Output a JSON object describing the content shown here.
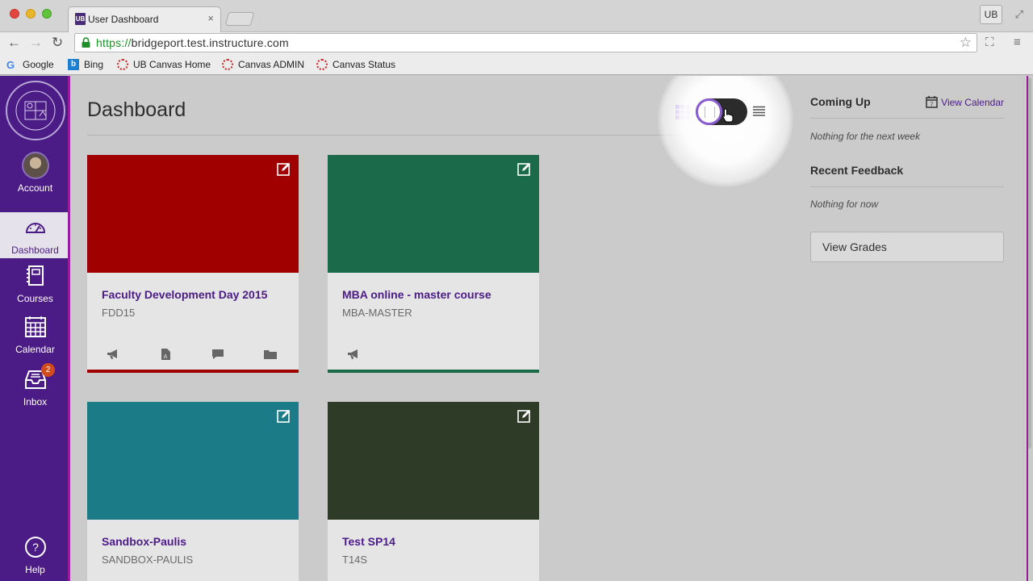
{
  "browser": {
    "tab_title": "User Dashboard",
    "tab_favicon": "UB",
    "tab_close": "×",
    "profile": "UB",
    "url_scheme": "https://",
    "url_rest": "bridgeport.test.instructure.com",
    "bookmarks": [
      {
        "label": "Google",
        "icon": "google-icon"
      },
      {
        "label": "Bing",
        "icon": "bing-icon"
      },
      {
        "label": "UB Canvas Home",
        "icon": "canvas-icon"
      },
      {
        "label": "Canvas ADMIN",
        "icon": "canvas-icon"
      },
      {
        "label": "Canvas Status",
        "icon": "canvas-icon"
      }
    ]
  },
  "nav": {
    "account": "Account",
    "dashboard": "Dashboard",
    "courses": "Courses",
    "calendar": "Calendar",
    "inbox": "Inbox",
    "inbox_badge": "2",
    "help": "Help"
  },
  "dashboard": {
    "title": "Dashboard",
    "view_mode": "card"
  },
  "courses": [
    {
      "name": "Faculty Development Day 2015",
      "code": "FDD15",
      "color": "#a00000",
      "icons": [
        "announcements-icon",
        "assignments-icon",
        "discussions-icon",
        "files-icon"
      ]
    },
    {
      "name": "MBA online - master course",
      "code": "MBA-MASTER",
      "color": "#1b6a49",
      "icons": [
        "announcements-icon"
      ]
    },
    {
      "name": "Sandbox-Paulis",
      "code": "SANDBOX-PAULIS",
      "color": "#1b7b86",
      "icons": []
    },
    {
      "name": "Test SP14",
      "code": "T14S",
      "color": "#2e3b27",
      "icons": []
    }
  ],
  "sidebar": {
    "coming_up": "Coming Up",
    "view_calendar": "View Calendar",
    "coming_up_empty": "Nothing for the next week",
    "recent_feedback": "Recent Feedback",
    "feedback_empty": "Nothing for now",
    "view_grades": "View Grades"
  },
  "colors": {
    "brand": "#4b1b86",
    "accent": "#9a1aa0"
  }
}
